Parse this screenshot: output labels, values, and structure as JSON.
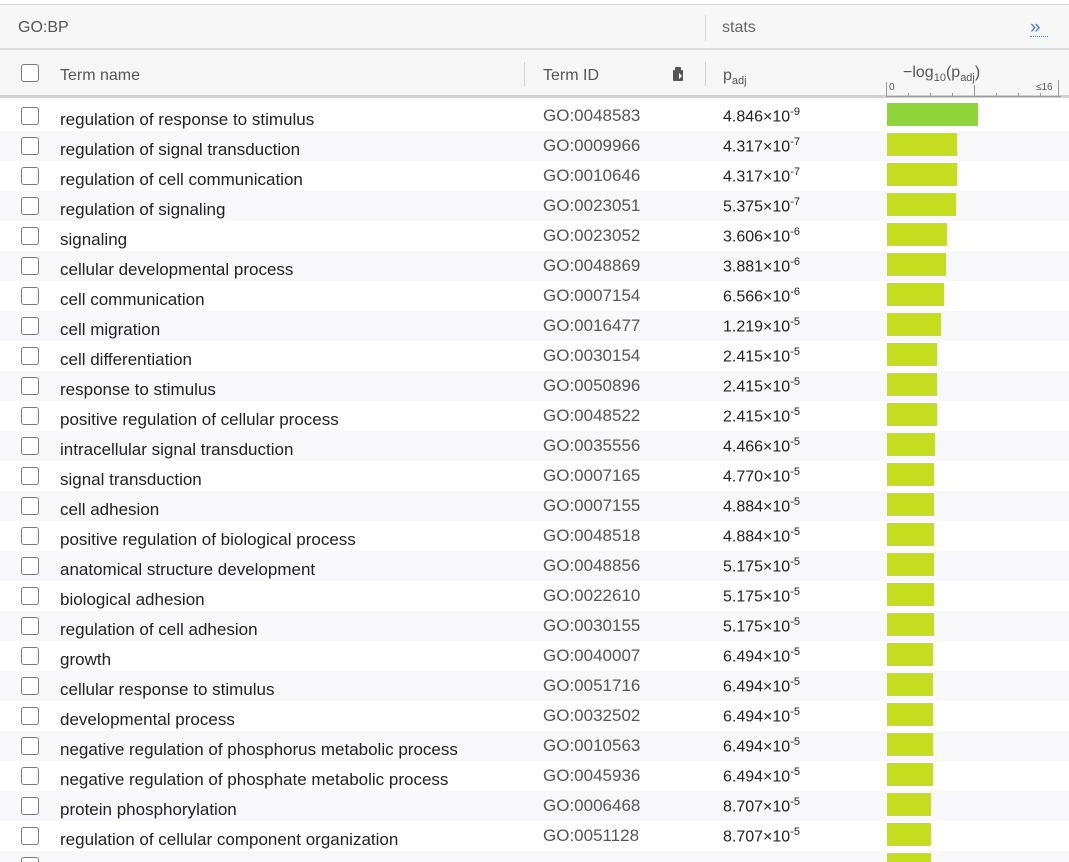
{
  "header": {
    "source": "GO:BP",
    "stats": "stats",
    "expand_icon": "»"
  },
  "columns": {
    "term_name": "Term name",
    "term_id": "Term ID",
    "padj_base": "p",
    "padj_sub": "adj",
    "logp_prefix": "−log",
    "logp_sub": "10",
    "logp_open": "(p",
    "logp_sub2": "adj",
    "logp_close": ")",
    "axis_min": "0",
    "axis_max": "≤16"
  },
  "bar_color_top": "#8fd43a",
  "bar_color": "#c5dd1f",
  "axis_max_value": 16,
  "rows": [
    {
      "name": "regulation of response to stimulus",
      "id": "GO:0048583",
      "mantissa": "4.846",
      "exp": "-9",
      "padj": 4.846e-09
    },
    {
      "name": "regulation of signal transduction",
      "id": "GO:0009966",
      "mantissa": "4.317",
      "exp": "-7",
      "padj": 4.317e-07
    },
    {
      "name": "regulation of cell communication",
      "id": "GO:0010646",
      "mantissa": "4.317",
      "exp": "-7",
      "padj": 4.317e-07
    },
    {
      "name": "regulation of signaling",
      "id": "GO:0023051",
      "mantissa": "5.375",
      "exp": "-7",
      "padj": 5.375e-07
    },
    {
      "name": "signaling",
      "id": "GO:0023052",
      "mantissa": "3.606",
      "exp": "-6",
      "padj": 3.606e-06
    },
    {
      "name": "cellular developmental process",
      "id": "GO:0048869",
      "mantissa": "3.881",
      "exp": "-6",
      "padj": 3.881e-06
    },
    {
      "name": "cell communication",
      "id": "GO:0007154",
      "mantissa": "6.566",
      "exp": "-6",
      "padj": 6.566e-06
    },
    {
      "name": "cell migration",
      "id": "GO:0016477",
      "mantissa": "1.219",
      "exp": "-5",
      "padj": 1.219e-05
    },
    {
      "name": "cell differentiation",
      "id": "GO:0030154",
      "mantissa": "2.415",
      "exp": "-5",
      "padj": 2.415e-05
    },
    {
      "name": "response to stimulus",
      "id": "GO:0050896",
      "mantissa": "2.415",
      "exp": "-5",
      "padj": 2.415e-05
    },
    {
      "name": "positive regulation of cellular process",
      "id": "GO:0048522",
      "mantissa": "2.415",
      "exp": "-5",
      "padj": 2.415e-05
    },
    {
      "name": "intracellular signal transduction",
      "id": "GO:0035556",
      "mantissa": "4.466",
      "exp": "-5",
      "padj": 4.466e-05
    },
    {
      "name": "signal transduction",
      "id": "GO:0007165",
      "mantissa": "4.770",
      "exp": "-5",
      "padj": 4.77e-05
    },
    {
      "name": "cell adhesion",
      "id": "GO:0007155",
      "mantissa": "4.884",
      "exp": "-5",
      "padj": 4.884e-05
    },
    {
      "name": "positive regulation of biological process",
      "id": "GO:0048518",
      "mantissa": "4.884",
      "exp": "-5",
      "padj": 4.884e-05
    },
    {
      "name": "anatomical structure development",
      "id": "GO:0048856",
      "mantissa": "5.175",
      "exp": "-5",
      "padj": 5.175e-05
    },
    {
      "name": "biological adhesion",
      "id": "GO:0022610",
      "mantissa": "5.175",
      "exp": "-5",
      "padj": 5.175e-05
    },
    {
      "name": "regulation of cell adhesion",
      "id": "GO:0030155",
      "mantissa": "5.175",
      "exp": "-5",
      "padj": 5.175e-05
    },
    {
      "name": "growth",
      "id": "GO:0040007",
      "mantissa": "6.494",
      "exp": "-5",
      "padj": 6.494e-05
    },
    {
      "name": "cellular response to stimulus",
      "id": "GO:0051716",
      "mantissa": "6.494",
      "exp": "-5",
      "padj": 6.494e-05
    },
    {
      "name": "developmental process",
      "id": "GO:0032502",
      "mantissa": "6.494",
      "exp": "-5",
      "padj": 6.494e-05
    },
    {
      "name": "negative regulation of phosphorus metabolic process",
      "id": "GO:0010563",
      "mantissa": "6.494",
      "exp": "-5",
      "padj": 6.494e-05
    },
    {
      "name": "negative regulation of phosphate metabolic process",
      "id": "GO:0045936",
      "mantissa": "6.494",
      "exp": "-5",
      "padj": 6.494e-05
    },
    {
      "name": "protein phosphorylation",
      "id": "GO:0006468",
      "mantissa": "8.707",
      "exp": "-5",
      "padj": 8.707e-05
    },
    {
      "name": "regulation of cellular component organization",
      "id": "GO:0051128",
      "mantissa": "8.707",
      "exp": "-5",
      "padj": 8.707e-05
    },
    {
      "name": "",
      "id": "",
      "mantissa": "",
      "exp": "",
      "padj": 9e-05
    }
  ]
}
